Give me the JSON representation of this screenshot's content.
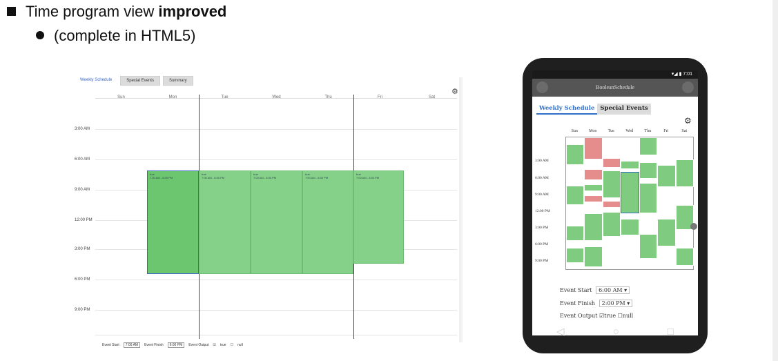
{
  "slide": {
    "bullet1_text": "Time program view ",
    "bullet1_bold": "improved",
    "bullet2_text": "(complete in HTML5)"
  },
  "desktop": {
    "tabs": [
      "Weekly Schedule",
      "Special Events",
      "Summary"
    ],
    "days": [
      "Sun",
      "Mon",
      "Tue",
      "Wed",
      "Thu",
      "Fri",
      "Sat"
    ],
    "times": [
      "3:00 AM",
      "6:00 AM",
      "9:00 AM",
      "12:00 PM",
      "3:00 PM",
      "6:00 PM",
      "9:00 PM"
    ],
    "events": [
      {
        "day": "Mon",
        "label": "true",
        "sub": "7:00 AM - 6:00 PM"
      },
      {
        "day": "Tue",
        "label": "true",
        "sub": "7:00 AM - 6:00 PM"
      },
      {
        "day": "Wed",
        "label": "true",
        "sub": "7:00 AM - 6:00 PM"
      },
      {
        "day": "Thu",
        "label": "true",
        "sub": "7:00 AM - 6:00 PM"
      },
      {
        "day": "Fri",
        "label": "true",
        "sub": "7:00 AM - 5:00 PM"
      }
    ],
    "footer": {
      "start_label": "Event Start",
      "start_value": "7:00 AM",
      "finish_label": "Event Finish",
      "finish_value": "6:00 PM",
      "output_label": "Event Output",
      "opt_true": "true",
      "opt_null": "null"
    }
  },
  "phone": {
    "status_time": "7:01",
    "app_title": "BooleanSchedule",
    "tabs": [
      "Weekly Schedule",
      "Special Events"
    ],
    "days": [
      "Sun",
      "Mon",
      "Tue",
      "Wed",
      "Thu",
      "Fri",
      "Sat"
    ],
    "times": [
      "3:00 AM",
      "6:00 AM",
      "9:00 AM",
      "12:00 PM",
      "3:00 PM",
      "6:00 PM",
      "9:00 PM"
    ],
    "event_start_label": "Event Start",
    "event_start_hour": "6",
    "event_start_min": "00",
    "event_start_ampm": "AM",
    "event_finish_label": "Event Finish",
    "event_finish_hour": "2",
    "event_finish_min": "00",
    "event_finish_ampm": "PM",
    "event_output_label": "Event Output",
    "opt_true": "true",
    "opt_null": "null"
  },
  "colors": {
    "green": "#85d189",
    "red": "#e58c8c",
    "accent": "#2f6fc9"
  }
}
